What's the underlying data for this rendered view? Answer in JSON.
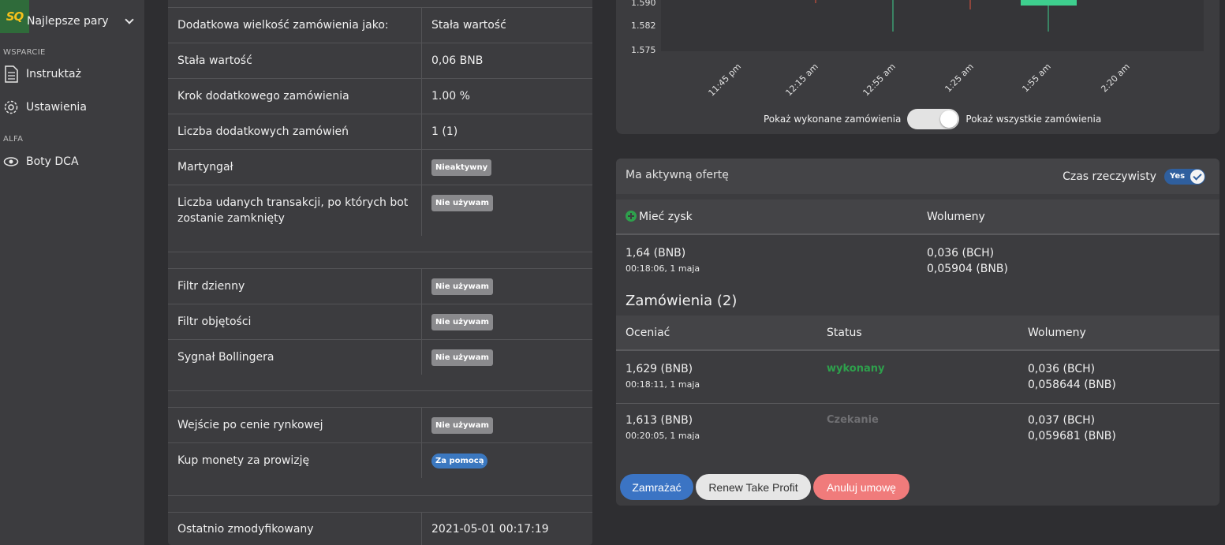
{
  "sidebar": {
    "logo_text": "SQ",
    "pairs_label": "Najlepsze pary",
    "section_support": "WSPARCIE",
    "instruction": "Instruktaż",
    "settings": "Ustawienia",
    "section_alpha": "ALFA",
    "dca_bots": "Boty DCA"
  },
  "settings_table": {
    "rows": [
      {
        "key": "Dodatkowa wielkość zamówienia jako:",
        "value": "Stała wartość"
      },
      {
        "key": "Stała wartość",
        "value": "0,06 BNB"
      },
      {
        "key": "Krok dodatkowego zamówienia",
        "value": "1.00 %"
      },
      {
        "key": "Liczba dodatkowych zamówień",
        "value": "1 (1)"
      },
      {
        "key": "Martyngał",
        "badge": "Nieaktywny"
      },
      {
        "key": "Liczba udanych transakcji, po których bot zostanie zamknięty",
        "badge": "Nie używam"
      },
      {
        "key": "Filtr dzienny",
        "badge": "Nie używam"
      },
      {
        "key": "Filtr objętości",
        "badge": "Nie używam"
      },
      {
        "key": "Sygnał Bollingera",
        "badge": "Nie używam"
      },
      {
        "key": "Wejście po cenie rynkowej",
        "badge": "Nie używam"
      },
      {
        "key": "Kup monety za prowizję",
        "badge": "Za pomocą"
      },
      {
        "key": "Ostatnio zmodyfikowany",
        "value": "2021-05-01 00:17:19"
      }
    ]
  },
  "chart_data": {
    "type": "candlestick",
    "y_ticks": [
      "1.590",
      "1.582",
      "1.575"
    ],
    "x_ticks": [
      "11:45 pm",
      "12:15 am",
      "12:55 am",
      "1:25 am",
      "1:55 am",
      "2:20 am"
    ],
    "colors": {
      "up": "#3ecf8e",
      "down": "#e8553e"
    }
  },
  "chart_controls": {
    "left_label": "Pokaż wykonane zamówienia",
    "right_label": "Pokaż wszystkie zamówienia"
  },
  "offer": {
    "title": "Ma aktywną ofertę",
    "realtime_label": "Czas rzeczywisty",
    "realtime_toggle": "Yes",
    "profit_header": "Mieć zysk",
    "volumes_header": "Wolumeny",
    "profit_price": "1,64 (BNB)",
    "profit_time": "00:18:06, 1 maja",
    "profit_vol1": "0,036 (BCH)",
    "profit_vol2": "0,05904 (BNB)",
    "orders_title": "Zamówienia (2)",
    "orders_headers": {
      "price": "Oceniać",
      "status": "Status",
      "volumes": "Wolumeny"
    },
    "orders": [
      {
        "price": "1,629 (BNB)",
        "time": "00:18:11, 1 maja",
        "status": "wykonany",
        "vol1": "0,036 (BCH)",
        "vol2": "0,058644 (BNB)"
      },
      {
        "price": "1,613 (BNB)",
        "time": "00:20:05, 1 maja",
        "status": "Czekanie",
        "vol1": "0,037 (BCH)",
        "vol2": "0,059681 (BNB)"
      }
    ],
    "buttons": {
      "freeze": "Zamrażać",
      "renew": "Renew Take Profit",
      "cancel": "Anuluj umowę"
    }
  }
}
